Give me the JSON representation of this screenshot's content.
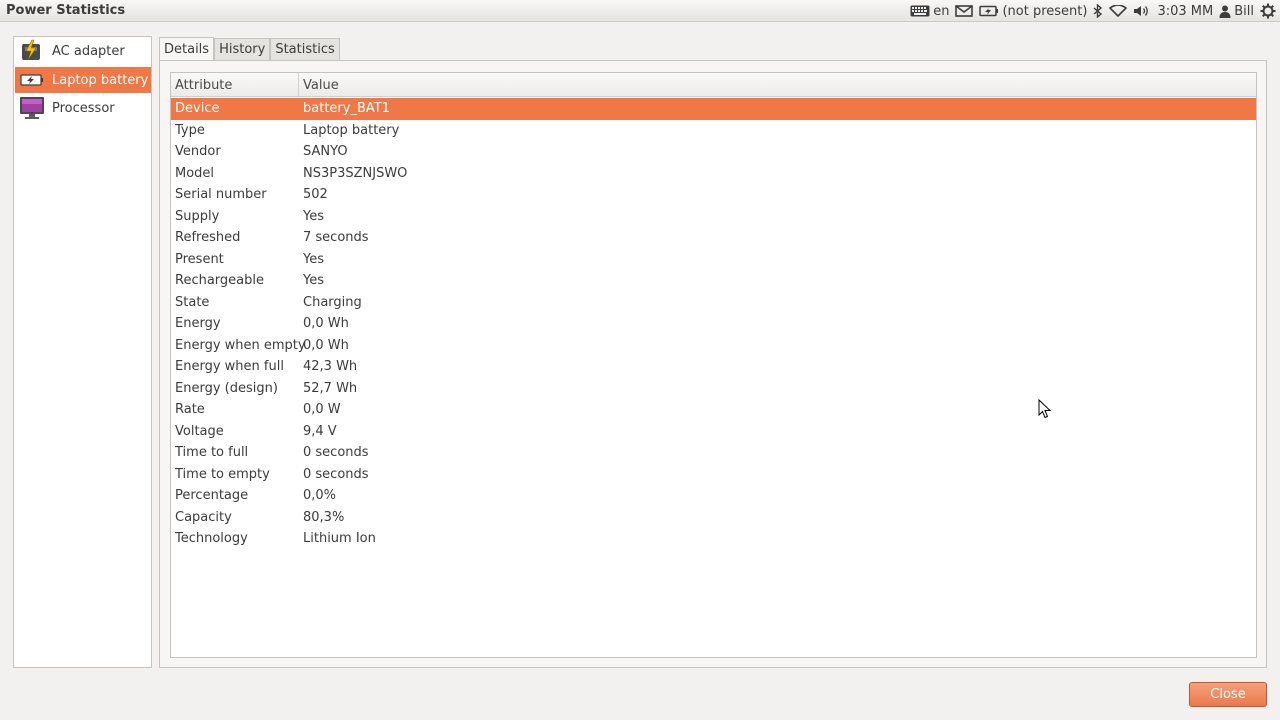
{
  "window": {
    "title": "Power Statistics"
  },
  "panel": {
    "keyboard_layout": "en",
    "battery_status": "(not present)",
    "clock": "3:03 MM",
    "user": "Bill",
    "icons": [
      "keyboard-icon",
      "mail-icon",
      "battery-icon",
      "bluetooth-icon",
      "wifi-icon",
      "volume-icon",
      "user-icon",
      "gear-icon"
    ]
  },
  "sidebar": {
    "items": [
      {
        "label": "AC adapter",
        "icon": "ac-adapter-icon",
        "selected": false
      },
      {
        "label": "Laptop battery",
        "icon": "battery-icon",
        "selected": true
      },
      {
        "label": "Processor",
        "icon": "processor-icon",
        "selected": false
      }
    ]
  },
  "tabs": [
    {
      "label": "Details",
      "active": true
    },
    {
      "label": "History",
      "active": false
    },
    {
      "label": "Statistics",
      "active": false
    }
  ],
  "table": {
    "headers": {
      "attribute": "Attribute",
      "value": "Value"
    },
    "rows": [
      {
        "attribute": "Device",
        "value": "battery_BAT1",
        "selected": true
      },
      {
        "attribute": "Type",
        "value": "Laptop battery"
      },
      {
        "attribute": "Vendor",
        "value": "SANYO"
      },
      {
        "attribute": "Model",
        "value": "NS3P3SZNJSWO"
      },
      {
        "attribute": "Serial number",
        "value": "502"
      },
      {
        "attribute": "Supply",
        "value": "Yes"
      },
      {
        "attribute": "Refreshed",
        "value": "7 seconds"
      },
      {
        "attribute": "Present",
        "value": "Yes"
      },
      {
        "attribute": "Rechargeable",
        "value": "Yes"
      },
      {
        "attribute": "State",
        "value": "Charging"
      },
      {
        "attribute": "Energy",
        "value": "0,0 Wh"
      },
      {
        "attribute": "Energy when empty",
        "value": "0,0 Wh"
      },
      {
        "attribute": "Energy when full",
        "value": "42,3 Wh"
      },
      {
        "attribute": "Energy (design)",
        "value": "52,7 Wh"
      },
      {
        "attribute": "Rate",
        "value": "0,0 W"
      },
      {
        "attribute": "Voltage",
        "value": "9,4 V"
      },
      {
        "attribute": "Time to full",
        "value": "0 seconds"
      },
      {
        "attribute": "Time to empty",
        "value": "0 seconds"
      },
      {
        "attribute": "Percentage",
        "value": "0,0%"
      },
      {
        "attribute": "Capacity",
        "value": "80,3%"
      },
      {
        "attribute": "Technology",
        "value": "Lithium Ion"
      }
    ]
  },
  "buttons": {
    "close": "Close"
  },
  "colors": {
    "accent": "#f07746",
    "background": "#f2f1f0"
  }
}
